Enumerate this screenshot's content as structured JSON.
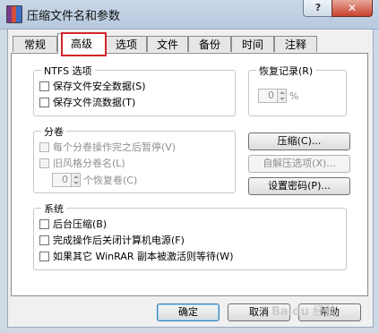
{
  "window": {
    "title": "压缩文件名和参数",
    "help_label": "?",
    "close_label": "✕"
  },
  "tabs": [
    "常规",
    "高级",
    "选项",
    "文件",
    "备份",
    "时间",
    "注释"
  ],
  "active_tab": "高级",
  "ntfs": {
    "title": "NTFS 选项",
    "items": [
      "保存文件安全数据(S)",
      "保存文件流数据(T)"
    ]
  },
  "recovery": {
    "title": "恢复记录(R)",
    "value": "0",
    "unit": "%"
  },
  "volumes": {
    "title": "分卷",
    "items": [
      "每个分卷操作完之后暂停(V)",
      "旧风格分卷名(L)"
    ],
    "recovery_value": "0",
    "recovery_label": "个恢复卷(C)"
  },
  "buttons": {
    "compression": "压缩(C)...",
    "sfx_options": "自解压选项(X)...",
    "set_password": "设置密码(P)..."
  },
  "system": {
    "title": "系统",
    "items": [
      "后台压缩(B)",
      "完成操作后关闭计算机电源(F)",
      "如果其它 WinRAR 副本被激活则等待(W)"
    ]
  },
  "footer": {
    "ok": "确定",
    "cancel": "取消",
    "help": "帮助"
  },
  "watermark": "Baidu 经验"
}
